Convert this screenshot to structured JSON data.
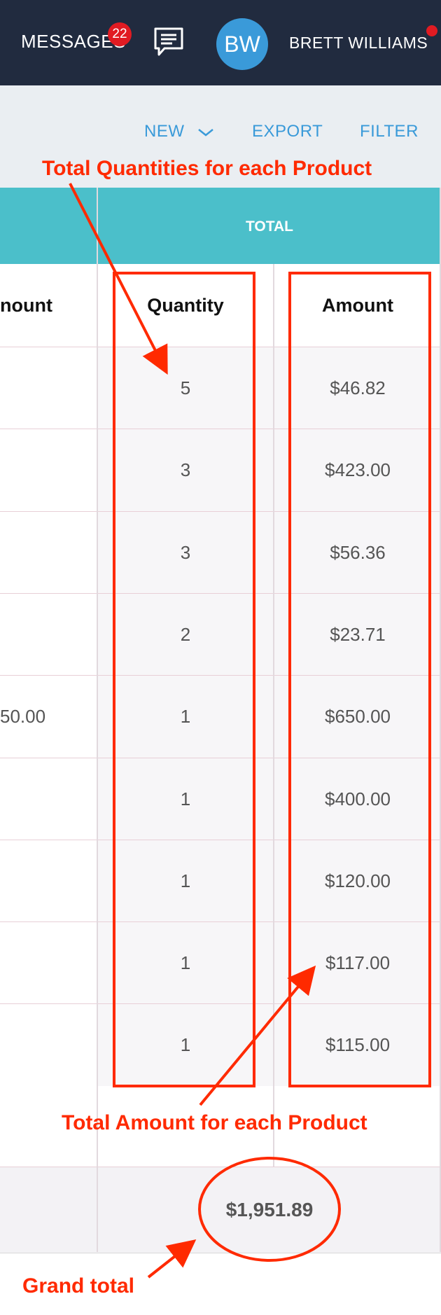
{
  "header": {
    "messages_label": "MESSAGES",
    "messages_count": "22",
    "avatar_initials": "BW",
    "user_name": "BRETT WILLIAMS"
  },
  "toolbar": {
    "new_label": "NEW",
    "export_label": "EXPORT",
    "filter_label": "FILTER"
  },
  "table": {
    "group_header": "TOTAL",
    "columns": {
      "left_partial": "nount",
      "quantity": "Quantity",
      "amount": "Amount"
    },
    "rows": [
      {
        "left": "",
        "quantity": "5",
        "amount": "$46.82"
      },
      {
        "left": "",
        "quantity": "3",
        "amount": "$423.00"
      },
      {
        "left": "",
        "quantity": "3",
        "amount": "$56.36"
      },
      {
        "left": "",
        "quantity": "2",
        "amount": "$23.71"
      },
      {
        "left": "50.00",
        "quantity": "1",
        "amount": "$650.00"
      },
      {
        "left": "",
        "quantity": "1",
        "amount": "$400.00"
      },
      {
        "left": "",
        "quantity": "1",
        "amount": "$120.00"
      },
      {
        "left": "",
        "quantity": "1",
        "amount": "$117.00"
      },
      {
        "left": "",
        "quantity": "1",
        "amount": "$115.00"
      }
    ],
    "grand_total": "$1,951.89"
  },
  "annotations": {
    "quantities_note": "Total Quantities for each Product",
    "amount_note": "Total Amount for each Product",
    "grand_total_note": "Grand total"
  },
  "colors": {
    "header_bg": "#212b3f",
    "accent_blue": "#3a9ad9",
    "teal_header": "#4bbfca",
    "badge_red": "#e11b22",
    "annotation_red": "#ff2a00"
  }
}
